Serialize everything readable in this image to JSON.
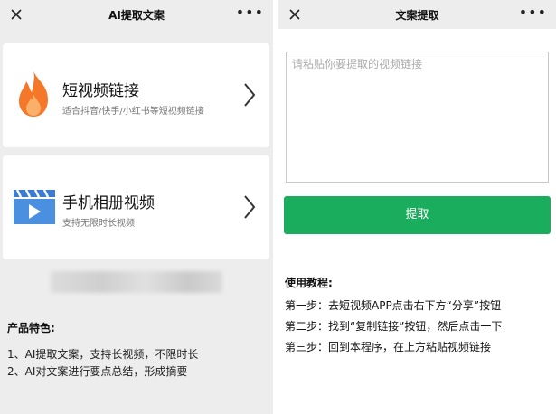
{
  "left_screen": {
    "title": "AI提取文案",
    "cards": [
      {
        "title": "短视频链接",
        "desc": "适合抖音/快手/小红书等短视频链接",
        "icon": "flame-icon",
        "icon_color": "#f5772a"
      },
      {
        "title": "手机相册视频",
        "desc": "支持无限时长视频",
        "icon": "video-clapper-icon",
        "icon_color": "#4a8fe0"
      }
    ],
    "features": {
      "title": "产品特色:",
      "items": [
        "1、AI提取文案，支持长视频，不限时长",
        "2、AI对文案进行要点总结，形成摘要"
      ]
    }
  },
  "right_screen": {
    "title": "文案提取",
    "input": {
      "placeholder": "请粘贴你要提取的视频链接",
      "value": ""
    },
    "extract_label": "提取",
    "tutorial": {
      "title": "使用教程:",
      "steps": [
        "第一步：去短视频APP点击右下方“分享”按钮",
        "第二步：找到“复制链接”按钮，然后点击一下",
        "第三步：回到本程序，在上方粘贴视频链接"
      ]
    }
  },
  "colors": {
    "accent_green": "#1aad5e",
    "page_gray": "#ededed"
  }
}
